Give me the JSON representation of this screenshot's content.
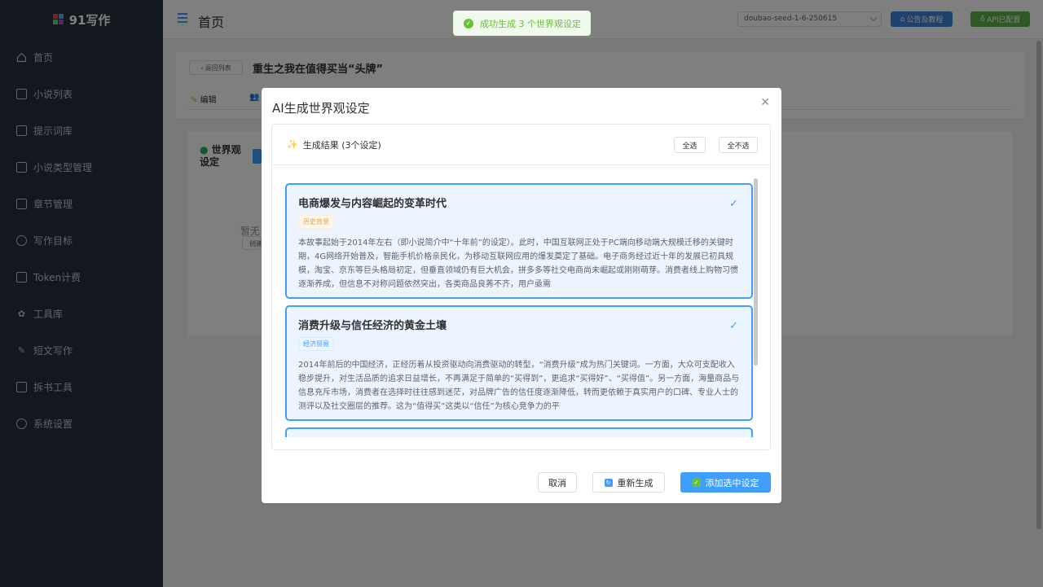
{
  "sidebar": {
    "logo": "91写作",
    "items": [
      {
        "label": "首页",
        "icon": "home-icon"
      },
      {
        "label": "小说列表",
        "icon": "document-icon"
      },
      {
        "label": "提示词库",
        "icon": "chat-icon"
      },
      {
        "label": "小说类型管理",
        "icon": "folder-icon"
      },
      {
        "label": "章节管理",
        "icon": "book-icon"
      },
      {
        "label": "写作目标",
        "icon": "target-icon"
      },
      {
        "label": "Token计费",
        "icon": "card-icon"
      },
      {
        "label": "工具库",
        "icon": "gear-icon"
      },
      {
        "label": "短文写作",
        "icon": "pen-icon"
      },
      {
        "label": "拆书工具",
        "icon": "cart-icon"
      },
      {
        "label": "系统设置",
        "icon": "settings-icon"
      }
    ]
  },
  "header": {
    "title": "首页",
    "model": "doubao-seed-1-6-250615",
    "notice_button": "公告及教程",
    "api_button": "API已配置"
  },
  "toast": {
    "text": "成功生成 3 个世界观设定"
  },
  "background": {
    "back_label": "返回列表",
    "novel_title": "重生之我在值得买当“头牌”",
    "tab_edit": "编辑",
    "world_heading_1": "世界观",
    "world_heading_2": "设定",
    "empty_text": "暂无",
    "empty_button": "创建"
  },
  "dialog": {
    "title": "AI生成世界观设定",
    "result_label": "生成结果 (3个设定)",
    "select_all": "全选",
    "select_none": "全不选",
    "items": [
      {
        "title": "电商爆发与内容崛起的变革时代",
        "tag": "历史背景",
        "text": "本故事起始于2014年左右（即小说简介中“十年前”的设定）。此时，中国互联网正处于PC端向移动端大规模迁移的关键时期，4G网络开始普及，智能手机价格亲民化，为移动互联网应用的爆发奠定了基础。电子商务经过近十年的发展已初具规模，淘宝、京东等巨头格局初定，但垂直领域仍有巨大机会，拼多多等社交电商尚未崛起或刚刚萌芽。消费者线上购物习惯逐渐养成，但信息不对称问题依然突出，各类商品良莠不齐，用户亟需",
        "selected": true
      },
      {
        "title": "消费升级与信任经济的黄金土壤",
        "tag": "经济贸易",
        "text": "2014年前后的中国经济，正经历着从投资驱动向消费驱动的转型，“消费升级”成为热门关键词。一方面，大众可支配收入稳步提升，对生活品质的追求日益增长，不再满足于简单的“买得到”，更追求“买得好”、“买得值”。另一方面，海量商品与信息充斥市场，消费者在选择时往往感到迷茫，对品牌广告的信任度逐渐降低，转而更依赖于真实用户的口碑、专业人士的测评以及社交圈层的推荐。这为“值得买”这类以“信任”为核心竞争力的平",
        "selected": true
      },
      {
        "title": "",
        "tag": "",
        "text": "",
        "selected": true
      }
    ],
    "cancel_button": "取消",
    "regenerate_button": "重新生成",
    "add_button": "添加选中设定"
  }
}
